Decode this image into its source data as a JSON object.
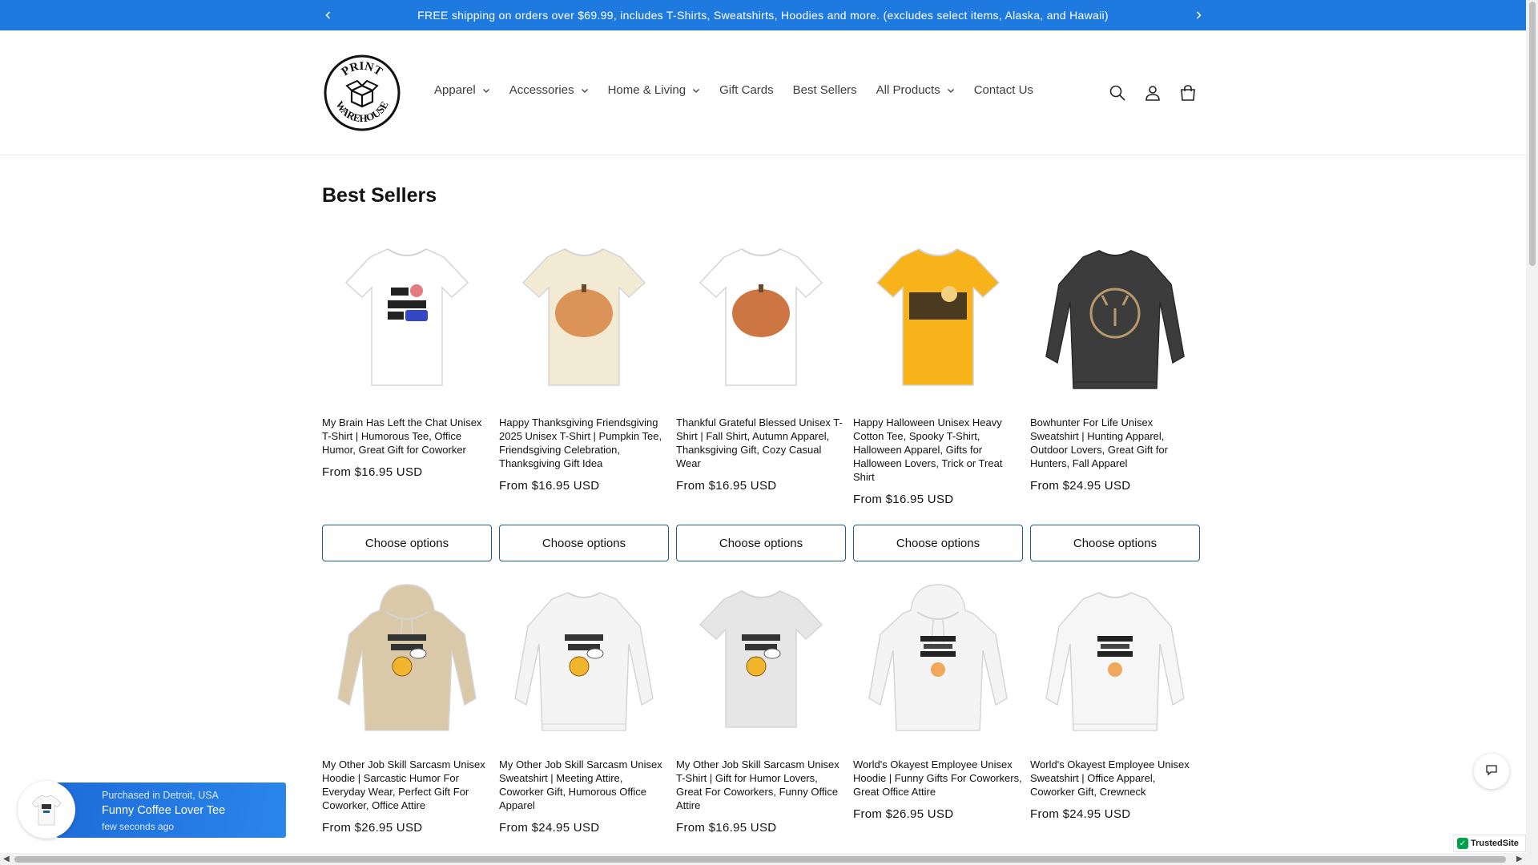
{
  "announcement": {
    "text": "FREE shipping on orders over $69.99, includes T-Shirts, Sweatshirts, Hoodies and more. (excludes select items, Alaska, and Hawaii)"
  },
  "logo": {
    "top_text": "PRINT",
    "bottom_text": "WAREHOUSE"
  },
  "nav": {
    "items": [
      {
        "label": "Apparel",
        "dropdown": true
      },
      {
        "label": "Accessories",
        "dropdown": true
      },
      {
        "label": "Home & Living",
        "dropdown": true
      },
      {
        "label": "Gift Cards",
        "dropdown": false
      },
      {
        "label": "Best Sellers",
        "dropdown": false
      },
      {
        "label": "All Products",
        "dropdown": true
      },
      {
        "label": "Contact Us",
        "dropdown": false
      }
    ]
  },
  "header_icons": [
    "search-icon",
    "account-icon",
    "cart-icon"
  ],
  "section": {
    "title": "Best Sellers"
  },
  "products": [
    {
      "title": "My Brain Has Left the Chat Unisex T-Shirt | Humorous Tee, Office Humor, Great Gift for Coworker",
      "price": "From $16.95 USD",
      "color": "#ffffff",
      "kind": "tee",
      "art": "MY 🧠 HAS LEFT THE CHAT"
    },
    {
      "title": "Happy Thanksgiving Friendsgiving 2025 Unisex T-Shirt | Pumpkin Tee, Friendsgiving Celebration, Thanksgiving Gift Idea",
      "price": "From $16.95 USD",
      "color": "#f3ead4",
      "kind": "tee",
      "art": "pumpkin"
    },
    {
      "title": "Thankful Grateful Blessed Unisex T-Shirt | Fall Shirt, Autumn Apparel, Thanksgiving Gift, Cozy Casual Wear",
      "price": "From $16.95 USD",
      "color": "#ffffff",
      "kind": "tee",
      "art": "pumpkin2"
    },
    {
      "title": "Happy Halloween Unisex Heavy Cotton Tee, Spooky T-Shirt, Halloween Apparel, Gifts for Halloween Lovers, Trick or Treat Shirt",
      "price": "From $16.95 USD",
      "color": "#f7b319",
      "kind": "tee",
      "art": "halloween"
    },
    {
      "title": "Bowhunter For Life Unisex Sweatshirt | Hunting Apparel, Outdoor Lovers, Great Gift for Hunters, Fall Apparel",
      "price": "From $24.95 USD",
      "color": "#3c3c3c",
      "kind": "sweat",
      "art": "deer"
    },
    {
      "title": "My Other Job Skill Sarcasm Unisex Hoodie | Sarcastic Humor For Everyday Wear, Perfect Gift For Coworker, Office Attire",
      "price": "From $26.95 USD",
      "color": "#d9c9a8",
      "kind": "hoodie",
      "art": "MY OTHER JOB SKILL"
    },
    {
      "title": "My Other Job Skill Sarcasm Unisex Sweatshirt | Meeting Attire, Coworker Gift, Humorous Office Apparel",
      "price": "From $24.95 USD",
      "color": "#f4f4f4",
      "kind": "sweat",
      "art": "MY OTHER JOB SKILL"
    },
    {
      "title": "My Other Job Skill Sarcasm Unisex T-Shirt | Gift for Humor Lovers, Great For Coworkers, Funny Office Attire",
      "price": "From $16.95 USD",
      "color": "#e6e6e6",
      "kind": "tee",
      "art": "MY OTHER JOB SKILL"
    },
    {
      "title": "World's Okayest Employee Unisex Hoodie | Funny Gifts For Coworkers, Great Office Attire",
      "price": "From $26.95 USD",
      "color": "#f4f4f4",
      "kind": "hoodie",
      "art": "WORLD'S OKAYEST EMPLOYEE"
    },
    {
      "title": "World's Okayest Employee Unisex Sweatshirt | Office Apparel, Coworker Gift, Crewneck",
      "price": "From $24.95 USD",
      "color": "#f6f6f6",
      "kind": "sweat",
      "art": "WORLD'S OKAYEST EMPLOYEE"
    }
  ],
  "choose_options_label": "Choose options",
  "popup": {
    "line1": "Purchased in Detroit, USA",
    "line2": "Funny Coffee Lover Tee",
    "line3": "few seconds ago"
  },
  "trusted": {
    "label": "TrustedSite"
  },
  "colors": {
    "announcement_bg": "#1f7ae0",
    "button_border": "#1f5f8b",
    "popup_bg": "#1e6cd9"
  }
}
